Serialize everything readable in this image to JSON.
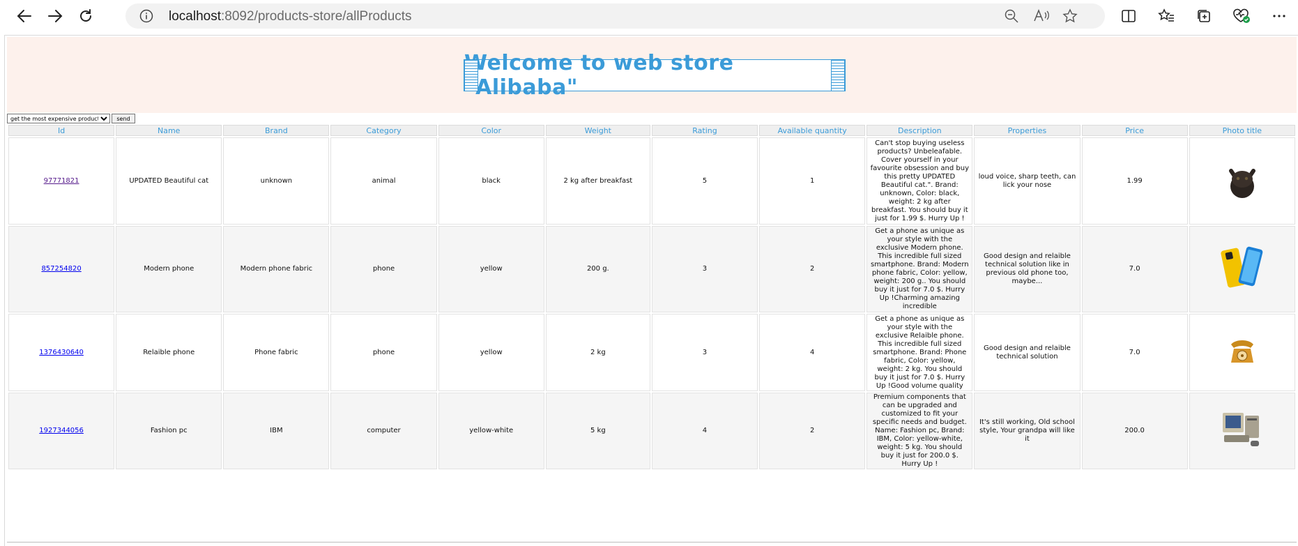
{
  "browser": {
    "url_host": "localhost",
    "url_rest": ":8092/products-store/allProducts"
  },
  "page": {
    "title": "Welcome to web store \"Alibaba\"",
    "filter_selected": "get the most expensive product",
    "send_label": "send"
  },
  "table": {
    "headers": [
      "Id",
      "Name",
      "Brand",
      "Category",
      "Color",
      "Weight",
      "Rating",
      "Available quantity",
      "Description",
      "Properties",
      "Price",
      "Photo title"
    ],
    "rows": [
      {
        "id": "97771821",
        "name": "UPDATED Beautiful cat",
        "brand": "unknown",
        "category": "animal",
        "color": "black",
        "weight": "2 kg after breakfast",
        "rating": "5",
        "quantity": "1",
        "description": "Can't stop buying useless products? Unbeleafable. Cover yourself in your favourite obsession and buy this pretty UPDATED Beautiful cat.\". Brand: unknown, Color: black, weight: 2 kg after breakfast. You should buy it just for 1.99 $. Hurry Up !",
        "properties": "loud voice, sharp teeth, can lick your nose",
        "price": "1.99",
        "photo": "cat-photo"
      },
      {
        "id": "857254820",
        "name": "Modern phone",
        "brand": "Modern phone fabric",
        "category": "phone",
        "color": "yellow",
        "weight": "200 g.",
        "rating": "3",
        "quantity": "2",
        "description": "Get a phone as unique as your style with the exclusive Modern phone. This incredible full sized smartphone. Brand: Modern phone fabric, Color: yellow, weight: 200 g.. You should buy it just for 7.0 $. Hurry Up !Charming amazing incredible",
        "properties": "Good design and relaible technical solution like in previous old phone too, maybe...",
        "price": "7.0",
        "photo": "smartphone-photo"
      },
      {
        "id": "1376430640",
        "name": "Relaible phone",
        "brand": "Phone fabric",
        "category": "phone",
        "color": "yellow",
        "weight": "2 kg",
        "rating": "3",
        "quantity": "4",
        "description": "Get a phone as unique as your style with the exclusive Relaible phone. This incredible full sized smartphone. Brand: Phone fabric, Color: yellow, weight: 2 kg. You should buy it just for 7.0 $. Hurry Up !Good volume quality",
        "properties": "Good design and relaible technical solution",
        "price": "7.0",
        "photo": "rotary-phone-photo"
      },
      {
        "id": "1927344056",
        "name": "Fashion pc",
        "brand": "IBM",
        "category": "computer",
        "color": "yellow-white",
        "weight": "5 kg",
        "rating": "4",
        "quantity": "2",
        "description": "Premium components that can be upgraded and customized to fit your specific needs and budget. Name: Fashion pc, Brand: IBM, Color: yellow-white, weight: 5 kg. You should buy it just for 200.0 $. Hurry Up !",
        "properties": "It's still working, Old school style, Your grandpa will like it",
        "price": "200.0",
        "photo": "old-pc-photo"
      }
    ]
  }
}
